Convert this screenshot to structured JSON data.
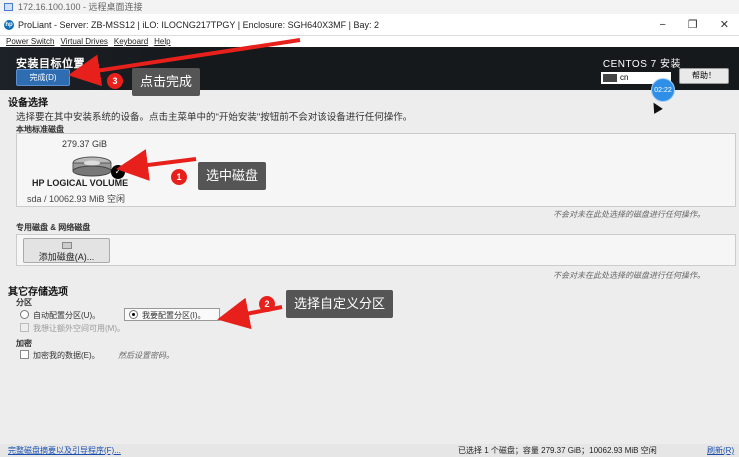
{
  "rdp": {
    "title": "172.16.100.100 - 远程桌面连接"
  },
  "window": {
    "title": "ProLiant - Server: ZB-MSS12 | iLO: ILOCNG217TPGY | Enclosure: SGH640X3MF | Bay: 2",
    "logo": "hp",
    "controls": {
      "minimize": "−",
      "restore": "❐",
      "close": "✕"
    }
  },
  "menu": {
    "items": [
      "Power Switch",
      "Virtual Drives",
      "Keyboard",
      "Help"
    ]
  },
  "header": {
    "title": "安装目标位置",
    "done_label": "完成(D)",
    "product": "CENTOS 7 安装",
    "keyboard": "cn",
    "help_label": "帮助！",
    "timer": "02:22"
  },
  "device_select": {
    "heading": "设备选择",
    "description": "选择要在其中安装系统的设备。点击主菜单中的\"开始安装\"按钮前不会对该设备进行任何操作。",
    "local_heading": "本地标准磁盘",
    "disk": {
      "size": "279.37 GiB",
      "name": "HP LOGICAL VOLUME",
      "info": "sda  /  10062.93 MiB 空闲",
      "selected": true
    },
    "local_note": "不会对未在此处选择的磁盘进行任何操作。",
    "special_heading": "专用磁盘 & 网络磁盘",
    "add_disk_label": "添加磁盘(A)...",
    "special_note": "不会对未在此处选择的磁盘进行任何操作。"
  },
  "other_options": {
    "heading": "其它存储选项",
    "partition_heading": "分区",
    "auto_label": "自动配置分区(U)。",
    "manual_label": "我要配置分区(I)。",
    "extra_space_label": "我想让额外空间可用(M)。",
    "encrypt_heading": "加密",
    "encrypt_label": "加密我的数据(E)。",
    "encrypt_hint": "然后设置密码。"
  },
  "statusbar": {
    "summary_link": "完整磁盘摘要以及引导程序(F)...",
    "status": "已选择 1 个磁盘；容量 279.37 GiB；10062.93 MiB 空闲",
    "refresh_link": "刷新(R)"
  },
  "annotations": {
    "step1": {
      "number": "1",
      "text": "选中磁盘"
    },
    "step2": {
      "number": "2",
      "text": "选择自定义分区"
    },
    "step3": {
      "number": "3",
      "text": "点击完成"
    }
  },
  "colors": {
    "accent": "#2f6db2",
    "annotation_red": "#e8201b",
    "callout_bg": "#555555",
    "header_bg": "#16191c"
  }
}
